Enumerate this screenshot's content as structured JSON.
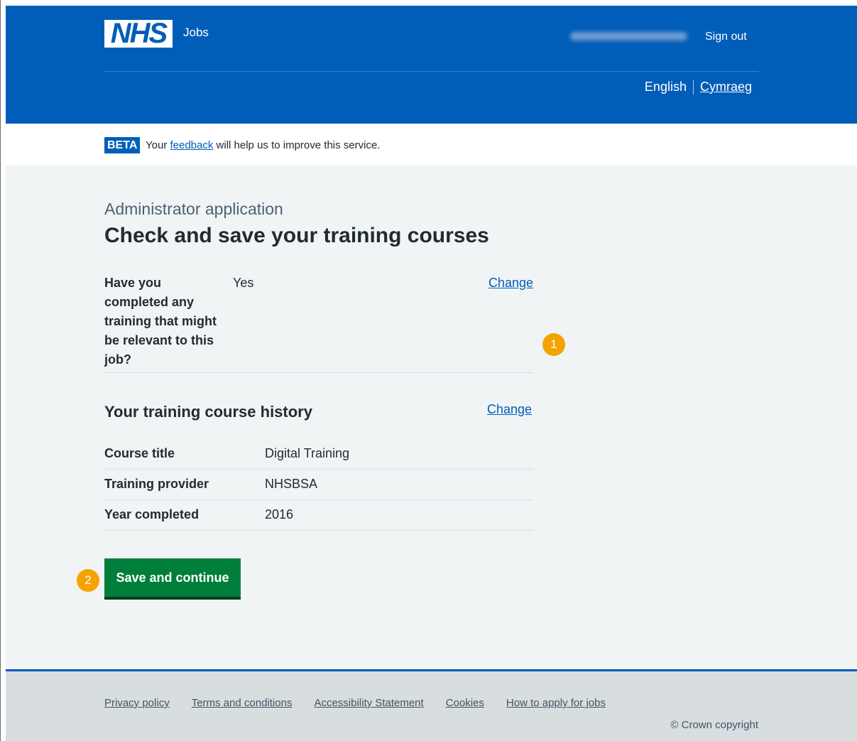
{
  "header": {
    "logo_text": "NHS",
    "service_name": "Jobs",
    "sign_out": "Sign out",
    "languages": {
      "english": "English",
      "welsh": "Cymraeg"
    }
  },
  "beta_banner": {
    "tag": "BETA",
    "text_before": "Your",
    "link": "feedback",
    "text_after": "will help us to improve this service."
  },
  "main": {
    "caption": "Administrator application",
    "title": "Check and save your training courses",
    "question": {
      "key": "Have you completed any training that might be relevant to this job?",
      "value": "Yes",
      "change": "Change"
    },
    "history": {
      "heading": "Your training course history",
      "change": "Change",
      "rows": [
        {
          "key": "Course title",
          "value": "Digital Training"
        },
        {
          "key": "Training provider",
          "value": "NHSBSA"
        },
        {
          "key": "Year completed",
          "value": "2016"
        }
      ]
    },
    "save_button": "Save and continue",
    "markers": [
      "1",
      "2"
    ]
  },
  "footer": {
    "links": [
      "Privacy policy",
      "Terms and conditions",
      "Accessibility Statement",
      "Cookies",
      "How to apply for jobs"
    ],
    "copyright": "© Crown copyright"
  },
  "colors": {
    "nhs_blue": "#005eb8",
    "button_green": "#007f3b",
    "marker_orange": "#f5a300",
    "background": "#f0f4f5"
  }
}
